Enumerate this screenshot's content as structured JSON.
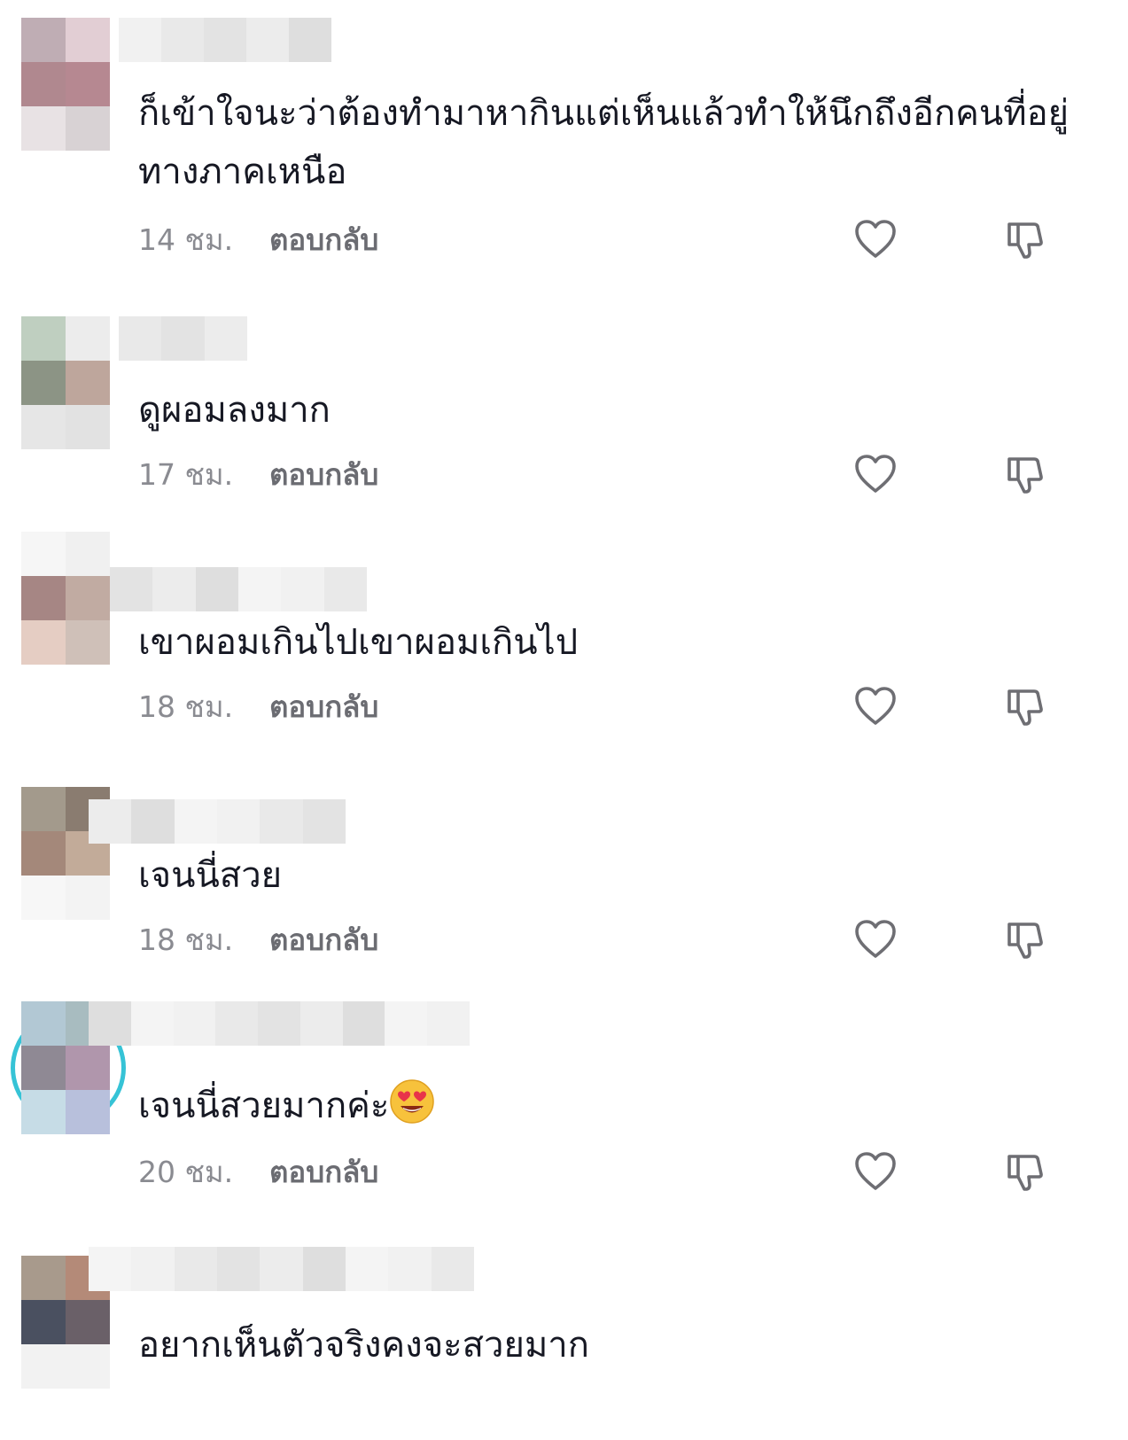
{
  "colors": {
    "text": "#161823",
    "muted": "#8a8b91",
    "reply": "#6b6c72",
    "icon": "#6e6e73",
    "story_ring": "#36c3d6"
  },
  "comments": [
    {
      "text": "ก็เข้าใจนะว่าต้องทำมาหากินแต่เห็นแล้วทำให้นึกถึงอีกคนที่อยู่ทางภาคเหนือ",
      "time": "14 ชม.",
      "reply": "ตอบกลับ",
      "like_icon": "heart-outline-icon",
      "dislike_icon": "thumbs-down-outline-icon",
      "avatar_colors": [
        "#bfadb4",
        "#e2ced4",
        "#b0888f",
        "#b68891",
        "#e8e2e4",
        "#d8d2d4"
      ]
    },
    {
      "text": "ดูผอมลงมาก",
      "time": "17 ชม.",
      "reply": "ตอบกลับ",
      "like_icon": "heart-outline-icon",
      "dislike_icon": "thumbs-down-outline-icon",
      "avatar_colors": [
        "#bfcfc0",
        "#ececec",
        "#8c9485",
        "#bea69c",
        "#e6e6e6",
        "#e2e2e2"
      ]
    },
    {
      "text": "เขาผอมเกินไปเขาผอมเกินไป",
      "time": "18 ชม.",
      "reply": "ตอบกลับ",
      "like_icon": "heart-outline-icon",
      "dislike_icon": "thumbs-down-outline-icon",
      "avatar_colors": [
        "#f6f6f6",
        "#f0f0f0",
        "#a68684",
        "#c1aba2",
        "#e5cdc3",
        "#cfc0b8"
      ]
    },
    {
      "text": "เจนนี่สวย",
      "time": "18 ชม.",
      "reply": "ตอบกลับ",
      "like_icon": "heart-outline-icon",
      "dislike_icon": "thumbs-down-outline-icon",
      "avatar_colors": [
        "#a39a8c",
        "#8a7c70",
        "#a4887a",
        "#c2ab99",
        "#f7f7f7",
        "#f3f3f3"
      ]
    },
    {
      "text": "เจนนี่สวยมากค่ะ",
      "emoji": "heart-eyes-emoji",
      "time": "20 ชม.",
      "reply": "ตอบกลับ",
      "like_icon": "heart-outline-icon",
      "dislike_icon": "thumbs-down-outline-icon",
      "avatar_colors": [
        "#b2c8d4",
        "#a8bcc0",
        "#8f8994",
        "#b096ac",
        "#c6dce6",
        "#b8c0dc"
      ],
      "story_ring": true
    },
    {
      "text": "อยากเห็นตัวจริงคงจะสวยมาก",
      "time": "",
      "reply": "",
      "like_icon": "heart-outline-icon",
      "dislike_icon": "thumbs-down-outline-icon",
      "avatar_colors": [
        "#a89a8c",
        "#b48a78",
        "#4a5060",
        "#6a6068",
        "#f2f2f2",
        "#f2f2f2"
      ]
    }
  ]
}
